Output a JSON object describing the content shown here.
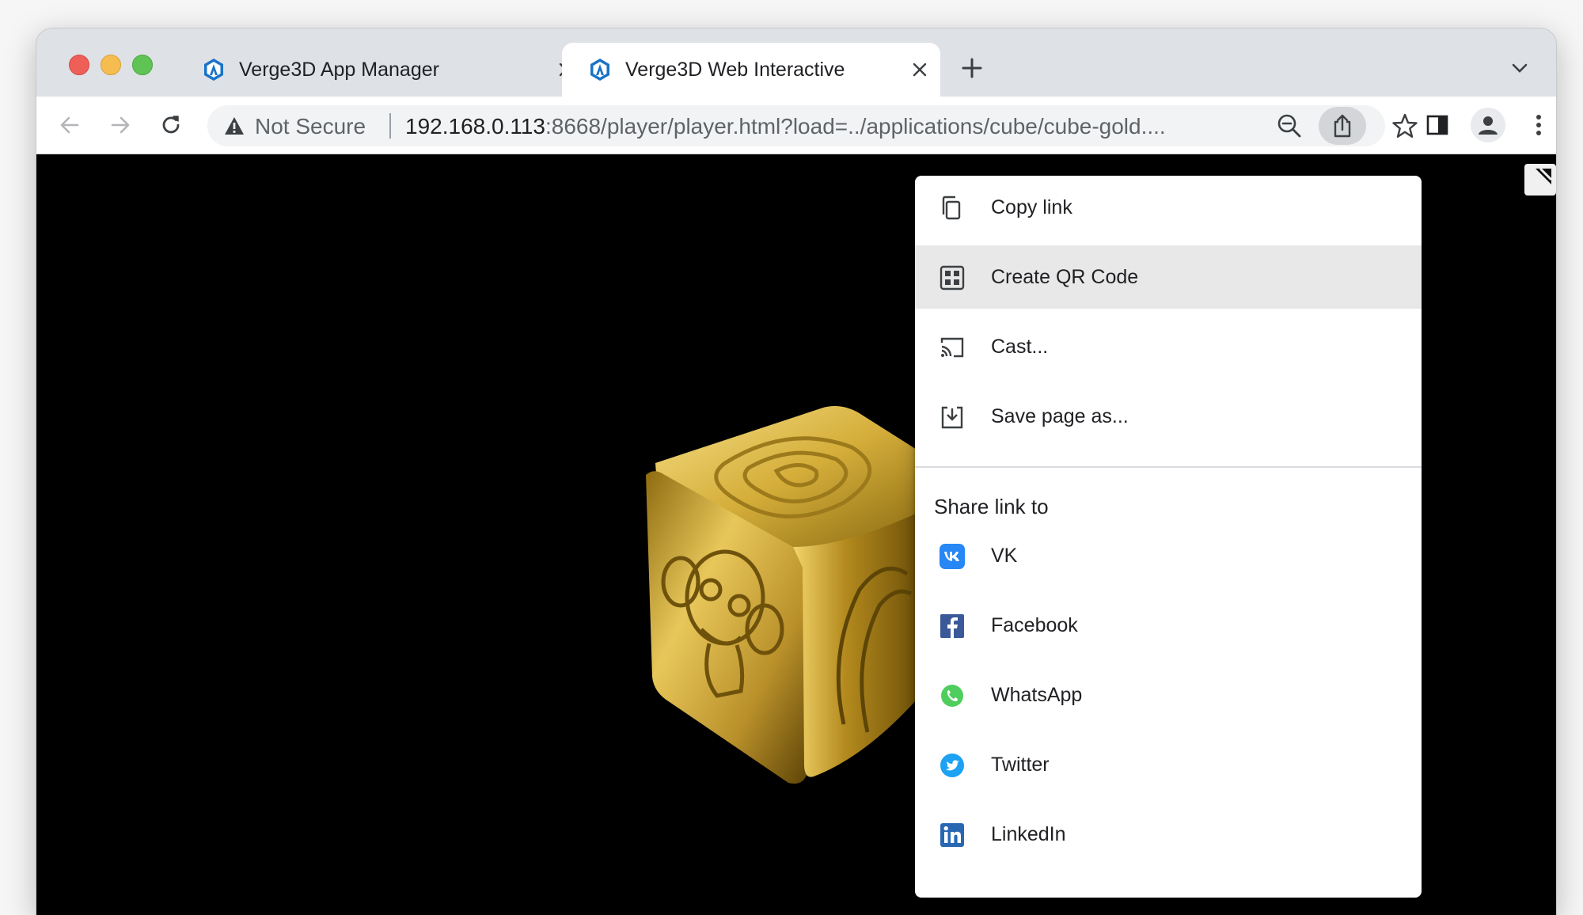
{
  "tabs": [
    {
      "title": "Verge3D App Manager",
      "active": false
    },
    {
      "title": "Verge3D Web Interactive",
      "active": true
    }
  ],
  "omnibox": {
    "security_label": "Not Secure",
    "url_host": "192.168.0.113",
    "url_rest": ":8668/player/player.html?load=../applications/cube/cube-gold...."
  },
  "share_menu": {
    "items": [
      {
        "label": "Copy link",
        "icon": "copy-icon"
      },
      {
        "label": "Create QR Code",
        "icon": "qr-code-icon",
        "highlighted": true
      },
      {
        "label": "Cast...",
        "icon": "cast-icon"
      },
      {
        "label": "Save page as...",
        "icon": "save-page-icon"
      }
    ],
    "share_header": "Share link to",
    "share_targets": [
      {
        "label": "VK",
        "icon": "vk-icon",
        "color": "#2787f5"
      },
      {
        "label": "Facebook",
        "icon": "facebook-icon",
        "color": "#3b5998"
      },
      {
        "label": "WhatsApp",
        "icon": "whatsapp-icon",
        "color": "#4fce5d"
      },
      {
        "label": "Twitter",
        "icon": "twitter-icon",
        "color": "#1da1f2"
      },
      {
        "label": "LinkedIn",
        "icon": "linkedin-icon",
        "color": "#2867b2"
      }
    ]
  },
  "colors": {
    "accent": "#1a73e8",
    "tab_strip": "#dee1e6",
    "viewport_bg": "#000000",
    "cube_gold": "#c9a227"
  }
}
